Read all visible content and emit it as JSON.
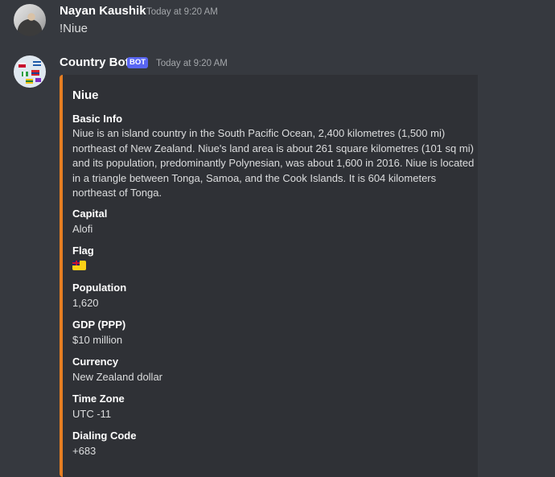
{
  "messages": [
    {
      "author": "Nayan Kaushik",
      "timestamp": "Today at 9:20 AM",
      "text": "!Niue"
    },
    {
      "author": "Country Bot",
      "badge": "BOT",
      "timestamp": "Today at 9:20 AM",
      "embed": {
        "accent_color": "#e67e22",
        "title": "Niue",
        "fields": [
          {
            "name": "Basic Info",
            "value": "Niue is an island country in the South Pacific Ocean, 2,400 kilometres (1,500 mi) northeast of New Zealand. Niue's land area is about 261 square kilometres (101 sq mi) and its population, predominantly Polynesian, was about 1,600 in 2016. Niue is located in a triangle between Tonga, Samoa, and the Cook Islands. It is 604 kilometers northeast of Tonga."
          },
          {
            "name": "Capital",
            "value": "Alofi"
          },
          {
            "name": "Flag",
            "value_icon": "niue-flag-emoji"
          },
          {
            "name": "Population",
            "value": "1,620"
          },
          {
            "name": "GDP (PPP)",
            "value": "$10 million"
          },
          {
            "name": "Currency",
            "value": "New Zealand dollar"
          },
          {
            "name": "Time Zone",
            "value": "UTC -11"
          },
          {
            "name": "Dialing Code",
            "value": "+683"
          }
        ]
      }
    }
  ],
  "colors": {
    "background": "#36393f",
    "embed_background": "#2f3136",
    "bot_badge": "#5865f2"
  }
}
